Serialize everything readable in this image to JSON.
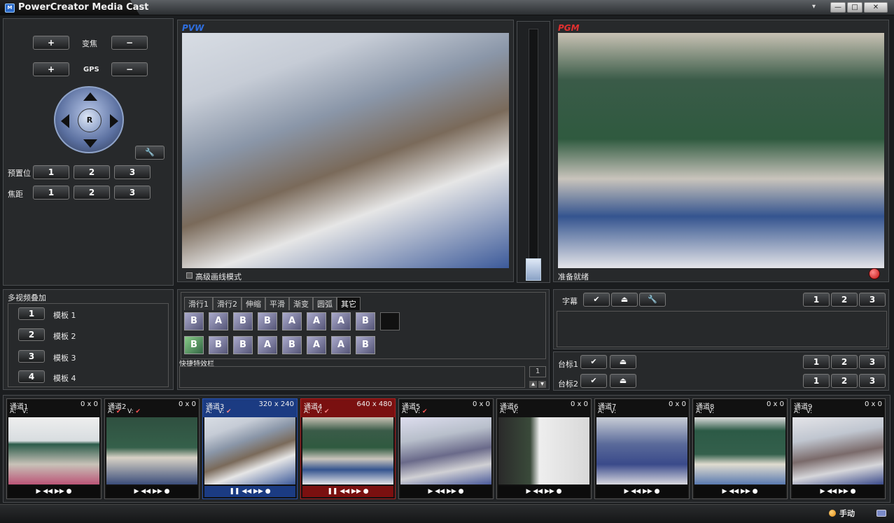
{
  "window": {
    "title": "PowerCreator Media Cast",
    "icon_text": "M",
    "menu_symbol": "▾",
    "min_symbol": "—",
    "max_symbol": "□",
    "close_symbol": "✕"
  },
  "camera": {
    "zoom_label": "变焦",
    "gps_label": "GPS",
    "plus": "+",
    "minus": "−",
    "dpad_center": "R",
    "wrench": "🔧",
    "preset_label": "预置位",
    "focus_label": "焦距",
    "presets": [
      "1",
      "2",
      "3"
    ],
    "focus": [
      "1",
      "2",
      "3"
    ]
  },
  "pvw": {
    "label": "PVW",
    "hq_label": "高级画线模式"
  },
  "pgm": {
    "label": "PGM",
    "status": "准备就绪"
  },
  "overlay": {
    "title": "多视频叠加",
    "templates": [
      {
        "num": "1",
        "label": "模板 1"
      },
      {
        "num": "2",
        "label": "模板 2"
      },
      {
        "num": "3",
        "label": "模板 3"
      },
      {
        "num": "4",
        "label": "模板 4"
      }
    ]
  },
  "effects": {
    "tabs": [
      "滑行1",
      "滑行2",
      "伸缩",
      "平滑",
      "渐变",
      "圆弧",
      "其它"
    ],
    "row1": [
      "B",
      "A",
      "B",
      "B",
      "A",
      "A",
      "A",
      "B"
    ],
    "row2": [
      "B",
      "B",
      "B",
      "A",
      "B",
      "A",
      "A",
      "B"
    ],
    "shortcut_label": "快捷特效栏",
    "page": "1",
    "up": "▲",
    "down": "▼"
  },
  "subtitle": {
    "label": "字幕",
    "check": "✔",
    "eject": "⏏",
    "wrench": "🔧",
    "nums": [
      "1",
      "2",
      "3"
    ]
  },
  "stations": [
    {
      "label": "台标1",
      "nums": [
        "1",
        "2",
        "3"
      ]
    },
    {
      "label": "台标2",
      "nums": [
        "1",
        "2",
        "3"
      ]
    }
  ],
  "channels": [
    {
      "name": "通道1",
      "res": "0 x 0",
      "a": "A:",
      "v": "V:",
      "a_ok": "",
      "v_ok": "",
      "controls": "▶ ◀◀ ▶▶ ●"
    },
    {
      "name": "通道2",
      "res": "0 x 0",
      "a": "A:",
      "v": "V:",
      "a_ok": "✔",
      "v_ok": "✔",
      "controls": "▶ ◀◀ ▶▶ ●"
    },
    {
      "name": "通道3",
      "res": "320 x 240",
      "a": "A:",
      "v": "V:",
      "a_ok": "",
      "v_ok": "✔",
      "controls": "❚❚ ◀◀ ▶▶ ●"
    },
    {
      "name": "通道4",
      "res": "640 x 480",
      "a": "A:",
      "v": "V:",
      "a_ok": "",
      "v_ok": "✔",
      "controls": "❚❚ ◀◀ ▶▶ ●"
    },
    {
      "name": "通道5",
      "res": "0 x 0",
      "a": "A:",
      "v": "V:",
      "a_ok": "",
      "v_ok": "✔",
      "controls": "▶ ◀◀ ▶▶ ●"
    },
    {
      "name": "通道6",
      "res": "0 x 0",
      "a": "A:",
      "v": "V:",
      "a_ok": "",
      "v_ok": "",
      "controls": "▶ ◀◀ ▶▶ ●"
    },
    {
      "name": "通道7",
      "res": "0 x 0",
      "a": "A:",
      "v": "V:",
      "a_ok": "",
      "v_ok": "",
      "controls": "▶ ◀◀ ▶▶ ●"
    },
    {
      "name": "通道8",
      "res": "0 x 0",
      "a": "A:",
      "v": "V:",
      "a_ok": "",
      "v_ok": "",
      "controls": "▶ ◀◀ ▶▶ ●"
    },
    {
      "name": "通道9",
      "res": "0 x 0",
      "a": "A:",
      "v": "V:",
      "a_ok": "",
      "v_ok": "",
      "controls": "▶ ◀◀ ▶▶ ●"
    }
  ],
  "statusbar": {
    "mode": "手动"
  },
  "colors": {
    "pvw": "#2f6fe0",
    "pgm": "#e03030",
    "active_blue": "#1b3b82",
    "active_red": "#7a1010"
  }
}
